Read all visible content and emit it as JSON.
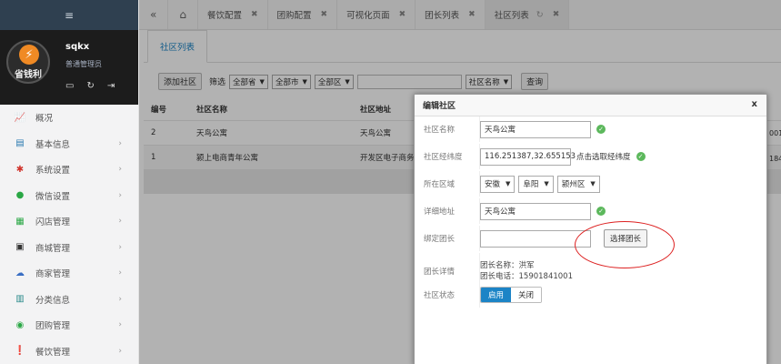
{
  "sidebar": {
    "menu_icon": "≡",
    "logo_text": "省钱利",
    "user_name": "sqkx",
    "user_role": "普通管理员",
    "items": [
      {
        "label": "概况",
        "icon": "chart-icon"
      },
      {
        "label": "基本信息",
        "icon": "list-icon"
      },
      {
        "label": "系统设置",
        "icon": "gear-icon"
      },
      {
        "label": "微信设置",
        "icon": "wechat-icon"
      },
      {
        "label": "闪店管理",
        "icon": "shop-icon"
      },
      {
        "label": "商城管理",
        "icon": "bag-icon"
      },
      {
        "label": "商家管理",
        "icon": "cloud-icon"
      },
      {
        "label": "分类信息",
        "icon": "card-icon"
      },
      {
        "label": "团购管理",
        "icon": "globe-icon"
      },
      {
        "label": "餐饮管理",
        "icon": "pin-icon"
      }
    ]
  },
  "tabs": [
    {
      "label": "餐饮配置"
    },
    {
      "label": "团购配置"
    },
    {
      "label": "可视化页面"
    },
    {
      "label": "团长列表"
    },
    {
      "label": "社区列表"
    }
  ],
  "content": {
    "sub_tab": "社区列表",
    "toolbar": {
      "add_button": "添加社区",
      "filter_label": "筛选",
      "province": "全部省",
      "city": "全部市",
      "district": "全部区",
      "field_select": "社区名称",
      "search_button": "查询"
    },
    "table": {
      "headers": [
        "编号",
        "社区名称",
        "社区地址"
      ],
      "rows": [
        [
          "2",
          "天鸟公寓",
          "天鸟公寓"
        ],
        [
          "1",
          "颍上电商青年公寓",
          "开发区电子商务"
        ]
      ],
      "right_clip": [
        "001",
        "184"
      ]
    }
  },
  "modal": {
    "title": "编辑社区",
    "close": "x",
    "fields": {
      "name_label": "社区名称",
      "name_value": "天鸟公寓",
      "coord_label": "社区经纬度",
      "coord_value": "116.251387,32.655153",
      "coord_hint": "点击选取经纬度",
      "region_label": "所在区域",
      "province": "安徽",
      "city": "阜阳",
      "district": "颍州区",
      "address_label": "详细地址",
      "address_value": "天鸟公寓",
      "bind_label": "绑定团长",
      "bind_button": "选择团长",
      "leader_label": "团长详情",
      "leader_name": "团长名称：洪军",
      "leader_phone": "团长电话：15901841001",
      "status_label": "社区状态",
      "status_on": "启用",
      "status_off": "关闭"
    }
  }
}
